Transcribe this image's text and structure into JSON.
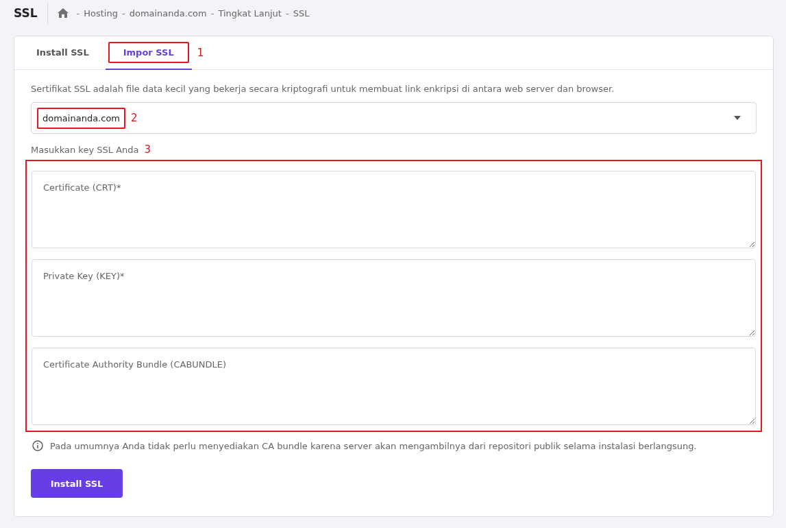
{
  "header": {
    "title": "SSL",
    "breadcrumb_separator": "-",
    "breadcrumb": [
      "Hosting",
      "domainanda.com",
      "Tingkat Lanjut",
      "SSL"
    ]
  },
  "tabs": [
    {
      "label": "Install SSL",
      "selected": false
    },
    {
      "label": "Impor SSL",
      "selected": true,
      "annotation": "1"
    }
  ],
  "description": "Sertifikat SSL adalah file data kecil yang bekerja secara kriptografi untuk membuat link enkripsi di antara web server dan browser.",
  "domain_select": {
    "value": "domainanda.com",
    "annotation": "2"
  },
  "keys_section": {
    "label": "Masukkan key SSL Anda",
    "annotation": "3",
    "fields": [
      {
        "placeholder": "Certificate (CRT)*"
      },
      {
        "placeholder": "Private Key (KEY)*"
      },
      {
        "placeholder": "Certificate Authority Bundle (CABUNDLE)"
      }
    ]
  },
  "info_note": "Pada umumnya Anda tidak perlu menyediakan CA bundle karena server akan mengambilnya dari repositori publik selama instalasi berlangsung.",
  "submit_button": "Install SSL"
}
